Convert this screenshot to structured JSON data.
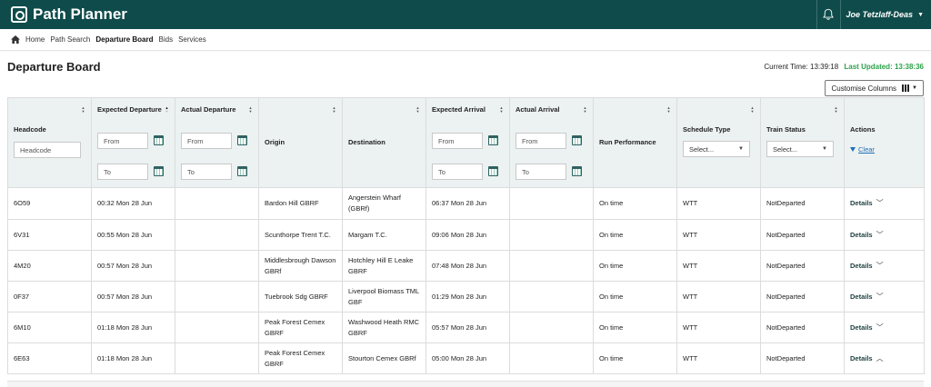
{
  "app": {
    "title": "Path Planner",
    "user_name": "Joe Tetzlaff-Deas"
  },
  "nav": {
    "items": [
      {
        "label": "Home",
        "active": false
      },
      {
        "label": "Path Search",
        "active": false
      },
      {
        "label": "Departure Board",
        "active": true
      },
      {
        "label": "Bids",
        "active": false
      },
      {
        "label": "Services",
        "active": false
      }
    ]
  },
  "page": {
    "title": "Departure Board",
    "current_time_label": "Current Time:",
    "current_time": "13:39:18",
    "last_updated_label": "Last Updated:",
    "last_updated": "13:38:36",
    "customise_label": "Customise Columns"
  },
  "colors": {
    "topbar": "#0f4b4b",
    "last_updated": "#2ca24a",
    "link": "#1f6fb5"
  },
  "table": {
    "headers": {
      "headcode": "Headcode",
      "expected_departure": "Expected Departure",
      "actual_departure": "Actual Departure",
      "origin": "Origin",
      "destination": "Destination",
      "expected_arrival": "Expected Arrival",
      "actual_arrival": "Actual Arrival",
      "run_performance": "Run Performance",
      "schedule_type": "Schedule Type",
      "train_status": "Train Status",
      "actions": "Actions"
    },
    "filters": {
      "headcode_placeholder": "Headcode",
      "from_placeholder": "From",
      "to_placeholder": "To",
      "select_placeholder": "Select...",
      "clear_label": "Clear"
    },
    "details_label": "Details",
    "rows": [
      {
        "headcode": "6O59",
        "expected_departure": "00:32 Mon 28 Jun",
        "actual_departure": "",
        "origin": "Bardon Hill GBRF",
        "destination": "Angerstein Wharf (GBRf)",
        "expected_arrival": "06:37 Mon 28 Jun",
        "actual_arrival": "",
        "run_performance": "On time",
        "schedule_type": "WTT",
        "train_status": "NotDeparted",
        "expanded": false
      },
      {
        "headcode": "6V31",
        "expected_departure": "00:55 Mon 28 Jun",
        "actual_departure": "",
        "origin": "Scunthorpe Trent T.C.",
        "destination": "Margam T.C.",
        "expected_arrival": "09:06 Mon 28 Jun",
        "actual_arrival": "",
        "run_performance": "On time",
        "schedule_type": "WTT",
        "train_status": "NotDeparted",
        "expanded": false
      },
      {
        "headcode": "4M20",
        "expected_departure": "00:57 Mon 28 Jun",
        "actual_departure": "",
        "origin": "Middlesbrough Dawson GBRf",
        "destination": "Hotchley Hill E Leake GBRF",
        "expected_arrival": "07:48 Mon 28 Jun",
        "actual_arrival": "",
        "run_performance": "On time",
        "schedule_type": "WTT",
        "train_status": "NotDeparted",
        "expanded": false
      },
      {
        "headcode": "0F37",
        "expected_departure": "00:57 Mon 28 Jun",
        "actual_departure": "",
        "origin": "Tuebrook Sdg GBRF",
        "destination": "Liverpool Biomass TML GBF",
        "expected_arrival": "01:29 Mon 28 Jun",
        "actual_arrival": "",
        "run_performance": "On time",
        "schedule_type": "WTT",
        "train_status": "NotDeparted",
        "expanded": false
      },
      {
        "headcode": "6M10",
        "expected_departure": "01:18 Mon 28 Jun",
        "actual_departure": "",
        "origin": "Peak Forest Cemex GBRF",
        "destination": "Washwood Heath RMC GBRF",
        "expected_arrival": "05:57 Mon 28 Jun",
        "actual_arrival": "",
        "run_performance": "On time",
        "schedule_type": "WTT",
        "train_status": "NotDeparted",
        "expanded": false
      },
      {
        "headcode": "6E63",
        "expected_departure": "01:18 Mon 28 Jun",
        "actual_departure": "",
        "origin": "Peak Forest Cemex GBRF",
        "destination": "Stourton Cemex GBRf",
        "expected_arrival": "05:00 Mon 28 Jun",
        "actual_arrival": "",
        "run_performance": "On time",
        "schedule_type": "WTT",
        "train_status": "NotDeparted",
        "expanded": true
      }
    ]
  }
}
